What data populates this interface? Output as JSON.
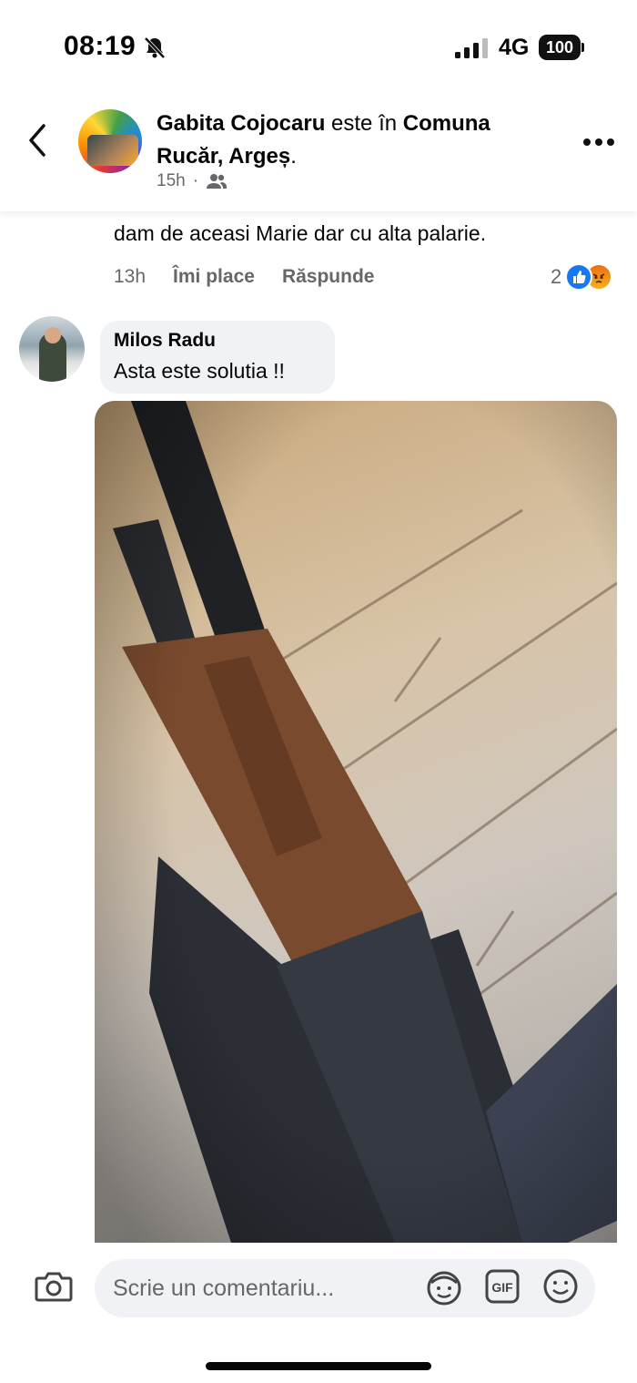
{
  "status_bar": {
    "time": "08:19",
    "network": "4G",
    "battery": "100"
  },
  "header": {
    "author": "Gabita Cojocaru",
    "connector": " este în ",
    "place": "Comuna Rucăr, Argeș",
    "time": "15h",
    "separator": "·",
    "audience_icon": "friends-icon"
  },
  "comment1": {
    "text": "dam de  aceasi Marie dar cu alta palarie.",
    "time": "13h",
    "like_label": "Îmi place",
    "reply_label": "Răspunde",
    "reaction_count": "2",
    "reaction_icons": [
      "like-icon",
      "angry-icon"
    ]
  },
  "comment2": {
    "author": "Milos Radu",
    "text": "Asta este solutia !!",
    "attachment_icon": "photo-attachment"
  },
  "composer": {
    "placeholder": "Scrie un comentariu...",
    "icons": [
      "camera-icon",
      "avatar-sticker-icon",
      "gif-icon",
      "emoji-icon"
    ]
  },
  "colors": {
    "accent": "#1877f2",
    "secondary_text": "#65676b",
    "bubble": "#f0f2f5"
  }
}
